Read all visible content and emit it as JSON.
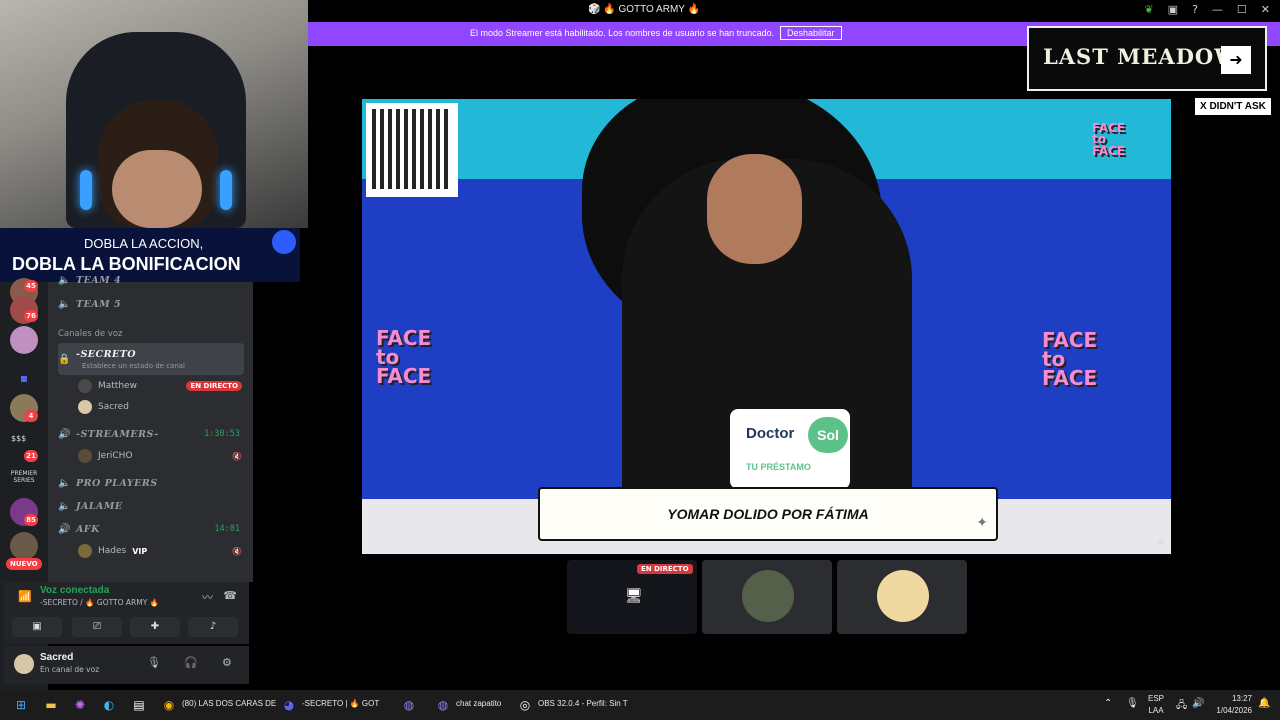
{
  "window": {
    "title": "🎲 🔥 GOTTO ARMY 🔥"
  },
  "streamer_banner": {
    "message": "El modo Streamer está habilitado. Los nombres de usuario se han truncado.",
    "button": "Deshabilitar"
  },
  "promo": {
    "line1": "DOBLA LA ACCION,",
    "line2": "DOBLA LA BONIFICACION"
  },
  "guilds": {
    "badges": [
      "45",
      "76",
      "4",
      "21",
      "85"
    ],
    "labels": [
      "$$$",
      "PREMIER SERIES"
    ],
    "new_label": "NUEVO"
  },
  "channels": {
    "team4": "TEAM 4",
    "team5": "TEAM 5",
    "voice_category": "Canales de voz",
    "secreto": {
      "name": "-SECRETO",
      "status_hint": "Establece un estado de canal"
    },
    "secreto_users": [
      {
        "name": "Matthew",
        "live": "EN DIRECTO"
      },
      {
        "name": "Sacred"
      }
    ],
    "streamers": {
      "name": "-STREAMERS-",
      "time": "1:30:53"
    },
    "streamers_users": [
      {
        "name": "JeriCHO"
      }
    ],
    "pro_players": "PRO PLAYERS",
    "jalame": "JALAME",
    "afk": {
      "name": "AFK",
      "time": "14:01"
    },
    "afk_users": [
      {
        "name": "Hades",
        "vip": "VIP"
      }
    ]
  },
  "voice_panel": {
    "status": "Voz conectada",
    "location": "-SECRETO / 🔥 GOTTO ARMY 🔥"
  },
  "user_panel": {
    "name": "Sacred",
    "status": "En canal de voz"
  },
  "stage": {
    "caption": "YOMAR DOLIDO POR FÁTIMA",
    "sponsor_name": "Doctor",
    "sponsor_badge": "Sol",
    "sponsor_tagline": "TU PRÉSTAMO",
    "logo_text": "FACE to FACE"
  },
  "thumbs": {
    "live_label": "EN DIRECTO"
  },
  "overlay": {
    "brand": "LAST MEADOW",
    "tag": "X DIDN'T ASK"
  },
  "taskbar": {
    "chrome_label": "(80) LAS DOS CARAS DE",
    "discord_label": "-SECRETO | 🔥 GOT",
    "chat_label": "chat zapatito",
    "obs_label": "OBS 32.0.4 - Perfil: Sin T",
    "lang_top": "ESP",
    "lang_bottom": "LAA",
    "time": "13:27",
    "date": "1/04/2026"
  }
}
